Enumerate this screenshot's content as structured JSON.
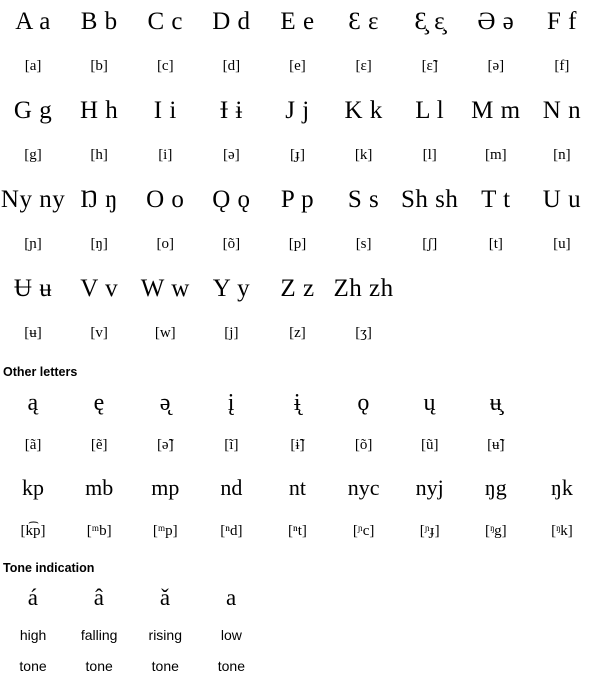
{
  "document": {
    "title": "Alphabet and pronunciation chart",
    "columns_per_row": 9,
    "background_color": "#ffffff",
    "text_color": "#000000"
  },
  "alphabet": {
    "rows": [
      {
        "letters": [
          "A a",
          "B b",
          "C c",
          "D d",
          "E e",
          "Ɛ ɛ",
          "Ɛ̧ ɛ̧",
          "Ə ə",
          "F f"
        ],
        "ipa": [
          "[a]",
          "[b]",
          "[c]",
          "[d]",
          "[e]",
          "[ɛ]",
          "[ɛ̃]",
          "[ə]",
          "[f]"
        ]
      },
      {
        "letters": [
          "G g",
          "H h",
          "I i",
          "Ɨ ɨ",
          "J j",
          "K k",
          "L l",
          "M m",
          "N n"
        ],
        "ipa": [
          "[g]",
          "[h]",
          "[i]",
          "[ə]",
          "[ɟ]",
          "[k]",
          "[l]",
          "[m]",
          "[n]"
        ]
      },
      {
        "letters": [
          "Ny ny",
          "Ŋ ŋ",
          "O o",
          "Ǫ ǫ",
          "P p",
          "S s",
          "Sh sh",
          "T t",
          "U u"
        ],
        "ipa": [
          "[ɲ]",
          "[ŋ]",
          "[o]",
          "[õ]",
          "[p]",
          "[s]",
          "[ʃ]",
          "[t]",
          "[u]"
        ]
      },
      {
        "letters": [
          "Ʉ ʉ",
          "V v",
          "W w",
          "Y y",
          "Z z",
          "Zh zh",
          "",
          "",
          ""
        ],
        "ipa": [
          "[ʉ]",
          "[v]",
          "[w]",
          "[j]",
          "[z]",
          "[ʒ]",
          "",
          "",
          ""
        ]
      }
    ]
  },
  "other_letters": {
    "heading": "Other letters",
    "vowels": {
      "letters": [
        "ą",
        "ę",
        "ǝ̨",
        "į",
        "ɨ̨",
        "ǫ",
        "ų",
        "ʉ̧",
        ""
      ],
      "ipa": [
        "[ã]",
        "[ẽ]",
        "[ə̃]",
        "[ĩ]",
        "[ɨ̃]",
        "[õ]",
        "[ũ]",
        "[ʉ̃]",
        ""
      ]
    },
    "clusters": {
      "letters": [
        "kp",
        "mb",
        "mp",
        "nd",
        "nt",
        "nyc",
        "nyj",
        "ŋg",
        "ŋk"
      ],
      "ipa": [
        "[k͡p]",
        "[ᵐb]",
        "[ᵐp]",
        "[ⁿd]",
        "[ⁿt]",
        "[ᶮc]",
        "[ᶮɟ]",
        "[ᵑg]",
        "[ᵑk]"
      ]
    }
  },
  "tone_indication": {
    "heading": "Tone indication",
    "marks": [
      "á",
      "â",
      "ǎ",
      "a",
      "",
      "",
      "",
      "",
      ""
    ],
    "labels_line1": [
      "high",
      "falling",
      "rising",
      "low",
      "",
      "",
      "",
      "",
      ""
    ],
    "labels_line2": [
      "tone",
      "tone",
      "tone",
      "tone",
      "",
      "",
      "",
      "",
      ""
    ]
  }
}
